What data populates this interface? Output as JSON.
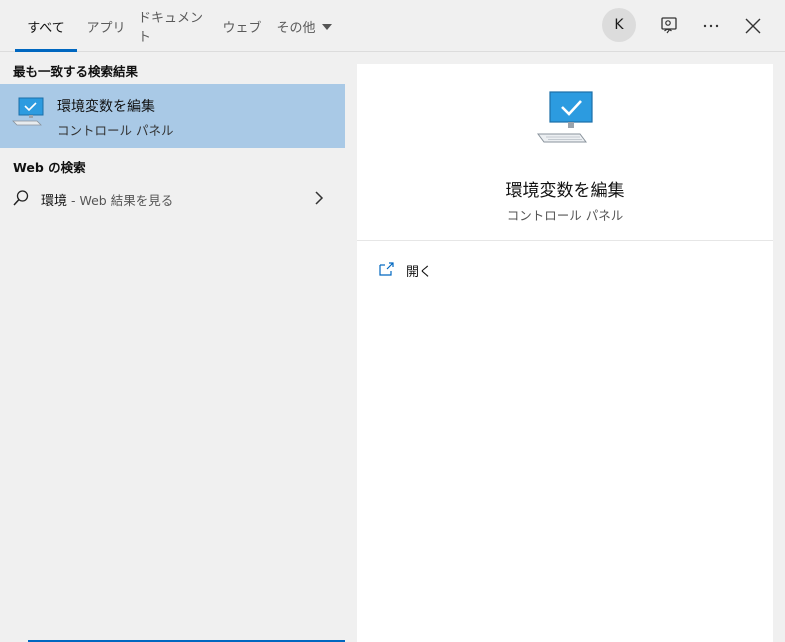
{
  "tabs": [
    {
      "label": "すべて",
      "active": true
    },
    {
      "label": "アプリ"
    },
    {
      "label": "ドキュメント"
    },
    {
      "label": "ウェブ"
    },
    {
      "label": "その他"
    }
  ],
  "header": {
    "avatar_initial": "K",
    "icons": [
      "feedback-icon",
      "more-icon",
      "close-icon"
    ]
  },
  "left": {
    "best_match_title": "最も一致する検索結果",
    "best_match": {
      "name": "環境変数を編集",
      "subtitle": "コントロール パネル",
      "icon": "computer-monitor-icon"
    },
    "web_section_title": "Web の検索",
    "web_result": {
      "query": "環境",
      "suffix": " - Web 結果を見る",
      "icon": "search-icon"
    }
  },
  "detail": {
    "name": "環境変数を編集",
    "subtitle": "コントロール パネル",
    "actions": [
      {
        "label": "開く",
        "icon": "open-external-icon"
      }
    ]
  },
  "colors": {
    "accent": "#0067c0",
    "selected_row": "#a9c9e6",
    "background": "#f0f0f0",
    "card": "#ffffff"
  }
}
